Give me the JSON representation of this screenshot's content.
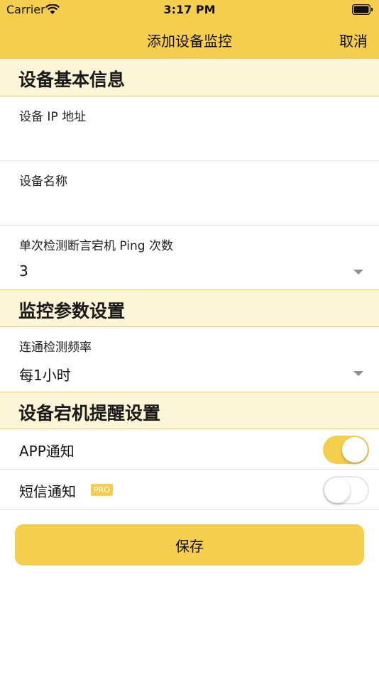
{
  "status_bar": {
    "carrier": "Carrier",
    "time": "3:17 PM"
  },
  "nav": {
    "title": "添加设备监控",
    "cancel": "取消"
  },
  "sections": {
    "basic": {
      "title": "设备基本信息"
    },
    "monitor": {
      "title": "监控参数设置"
    },
    "alert": {
      "title": "设备宕机提醒设置"
    }
  },
  "fields": {
    "ip": {
      "label": "设备 IP 地址",
      "value": ""
    },
    "name": {
      "label": "设备名称",
      "value": ""
    },
    "ping": {
      "label": "单次检测断言宕机 Ping 次数",
      "value": "3"
    },
    "freq": {
      "label": "连通检测频率",
      "value": "每1小时"
    }
  },
  "toggles": {
    "app": {
      "label": "APP通知",
      "on": true
    },
    "sms": {
      "label": "短信通知",
      "badge": "PRO",
      "on": false
    }
  },
  "save": {
    "label": "保存"
  },
  "colors": {
    "accent": "#f5ce4e",
    "section_bg": "#fdf5d8"
  }
}
